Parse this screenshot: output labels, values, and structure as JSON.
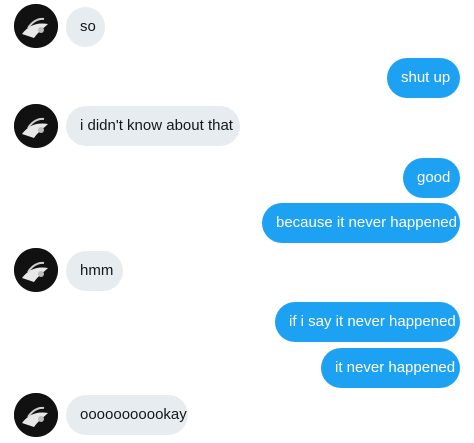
{
  "messages": [
    {
      "sender": "other",
      "text": "so"
    },
    {
      "sender": "me",
      "text": "shut up"
    },
    {
      "sender": "other",
      "text": "i didn't know about that"
    },
    {
      "sender": "me",
      "text": "good"
    },
    {
      "sender": "me",
      "text": "because it never happened"
    },
    {
      "sender": "other",
      "text": "hmm"
    },
    {
      "sender": "me",
      "text": "if i say it never happened"
    },
    {
      "sender": "me",
      "text": "it never happened"
    },
    {
      "sender": "other",
      "text": "ooooooooookay"
    }
  ],
  "colors": {
    "incoming_bubble": "#e6ecf0",
    "outgoing_bubble": "#1da1f2",
    "avatar_background": "#111111"
  },
  "icons": {
    "avatar": "user-avatar-icon"
  }
}
